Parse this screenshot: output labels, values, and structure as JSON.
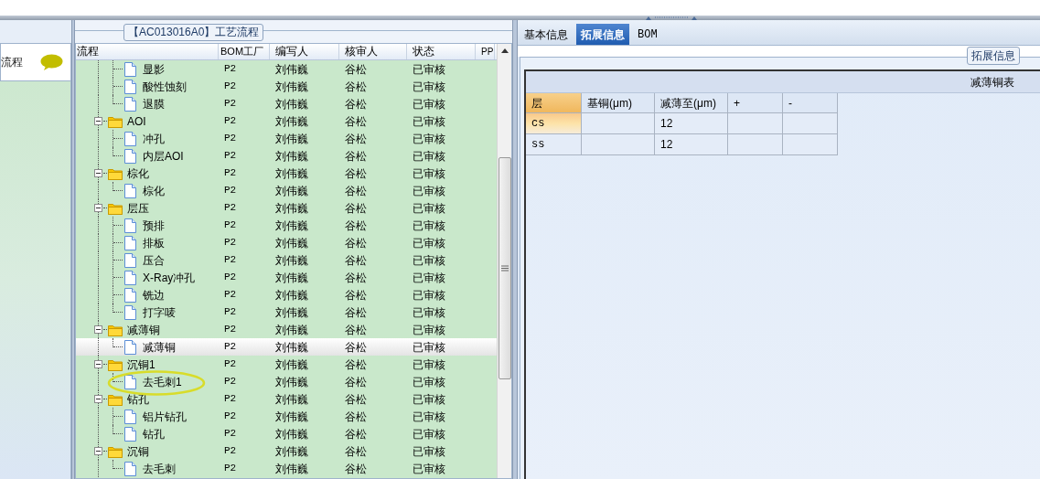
{
  "left_panel": {
    "title": "流程"
  },
  "process_panel": {
    "title": "【AC013016A0】工艺流程",
    "columns": [
      "流程",
      "BOM工厂",
      "编写人",
      "核审人",
      "状态",
      "PP"
    ],
    "tree": [
      {
        "kind": "hidden-parent",
        "children": [
          {
            "kind": "file",
            "label": "显影",
            "bom": "P2",
            "writer": "刘伟巍",
            "reviewer": "谷松",
            "status": "已审核",
            "selected": false
          },
          {
            "kind": "file",
            "label": "酸性蚀刻",
            "bom": "P2",
            "writer": "刘伟巍",
            "reviewer": "谷松",
            "status": "已审核",
            "selected": false
          },
          {
            "kind": "file",
            "label": "退膜",
            "bom": "P2",
            "writer": "刘伟巍",
            "reviewer": "谷松",
            "status": "已审核",
            "selected": false
          }
        ]
      },
      {
        "kind": "folder",
        "label": "AOI",
        "bom": "P2",
        "writer": "刘伟巍",
        "reviewer": "谷松",
        "status": "已审核",
        "selected": false,
        "expanded": true,
        "children": [
          {
            "kind": "file",
            "label": "冲孔",
            "bom": "P2",
            "writer": "刘伟巍",
            "reviewer": "谷松",
            "status": "已审核",
            "selected": false
          },
          {
            "kind": "file",
            "label": "内层AOI",
            "bom": "P2",
            "writer": "刘伟巍",
            "reviewer": "谷松",
            "status": "已审核",
            "selected": false
          }
        ]
      },
      {
        "kind": "folder",
        "label": "棕化",
        "bom": "P2",
        "writer": "刘伟巍",
        "reviewer": "谷松",
        "status": "已审核",
        "selected": false,
        "expanded": true,
        "children": [
          {
            "kind": "file",
            "label": "棕化",
            "bom": "P2",
            "writer": "刘伟巍",
            "reviewer": "谷松",
            "status": "已审核",
            "selected": false
          }
        ]
      },
      {
        "kind": "folder",
        "label": "层压",
        "bom": "P2",
        "writer": "刘伟巍",
        "reviewer": "谷松",
        "status": "已审核",
        "selected": false,
        "expanded": true,
        "children": [
          {
            "kind": "file",
            "label": "预排",
            "bom": "P2",
            "writer": "刘伟巍",
            "reviewer": "谷松",
            "status": "已审核",
            "selected": false
          },
          {
            "kind": "file",
            "label": "排板",
            "bom": "P2",
            "writer": "刘伟巍",
            "reviewer": "谷松",
            "status": "已审核",
            "selected": false
          },
          {
            "kind": "file",
            "label": "压合",
            "bom": "P2",
            "writer": "刘伟巍",
            "reviewer": "谷松",
            "status": "已审核",
            "selected": false
          },
          {
            "kind": "file",
            "label": "X-Ray冲孔",
            "bom": "P2",
            "writer": "刘伟巍",
            "reviewer": "谷松",
            "status": "已审核",
            "selected": false
          },
          {
            "kind": "file",
            "label": "铣边",
            "bom": "P2",
            "writer": "刘伟巍",
            "reviewer": "谷松",
            "status": "已审核",
            "selected": false
          },
          {
            "kind": "file",
            "label": "打字唛",
            "bom": "P2",
            "writer": "刘伟巍",
            "reviewer": "谷松",
            "status": "已审核",
            "selected": false
          }
        ]
      },
      {
        "kind": "folder",
        "label": "减薄铜",
        "bom": "P2",
        "writer": "刘伟巍",
        "reviewer": "谷松",
        "status": "已审核",
        "selected": false,
        "expanded": true,
        "children": [
          {
            "kind": "file",
            "label": "减薄铜",
            "bom": "P2",
            "writer": "刘伟巍",
            "reviewer": "谷松",
            "status": "已审核",
            "selected": true
          }
        ]
      },
      {
        "kind": "folder",
        "label": "沉铜1",
        "bom": "P2",
        "writer": "刘伟巍",
        "reviewer": "谷松",
        "status": "已审核",
        "selected": false,
        "expanded": true,
        "children": [
          {
            "kind": "file",
            "label": "去毛刺1",
            "bom": "P2",
            "writer": "刘伟巍",
            "reviewer": "谷松",
            "status": "已审核",
            "selected": false
          }
        ]
      },
      {
        "kind": "folder",
        "label": "钻孔",
        "bom": "P2",
        "writer": "刘伟巍",
        "reviewer": "谷松",
        "status": "已审核",
        "selected": false,
        "expanded": true,
        "children": [
          {
            "kind": "file",
            "label": "铝片钻孔",
            "bom": "P2",
            "writer": "刘伟巍",
            "reviewer": "谷松",
            "status": "已审核",
            "selected": false
          },
          {
            "kind": "file",
            "label": "钻孔",
            "bom": "P2",
            "writer": "刘伟巍",
            "reviewer": "谷松",
            "status": "已审核",
            "selected": false
          }
        ]
      },
      {
        "kind": "folder",
        "label": "沉铜",
        "bom": "P2",
        "writer": "刘伟巍",
        "reviewer": "谷松",
        "status": "已审核",
        "selected": false,
        "expanded": true,
        "children": [
          {
            "kind": "file",
            "label": "去毛刺",
            "bom": "P2",
            "writer": "刘伟巍",
            "reviewer": "谷松",
            "status": "已审核",
            "selected": false
          }
        ]
      }
    ]
  },
  "detail_panel": {
    "tabs": [
      {
        "label": "基本信息",
        "selected": false
      },
      {
        "label": "拓展信息",
        "selected": true
      },
      {
        "label": "BOM",
        "selected": false
      }
    ],
    "group_title": "拓展信息",
    "table": {
      "caption": "减薄铜表",
      "columns": [
        "层",
        "基铜(μm)",
        "减薄至(μm)",
        "+",
        "-"
      ],
      "rows": [
        {
          "cells": [
            "cs",
            "",
            "12",
            "",
            ""
          ],
          "selected": true
        },
        {
          "cells": [
            "ss",
            "",
            "12",
            "",
            ""
          ],
          "selected": false
        }
      ]
    }
  }
}
